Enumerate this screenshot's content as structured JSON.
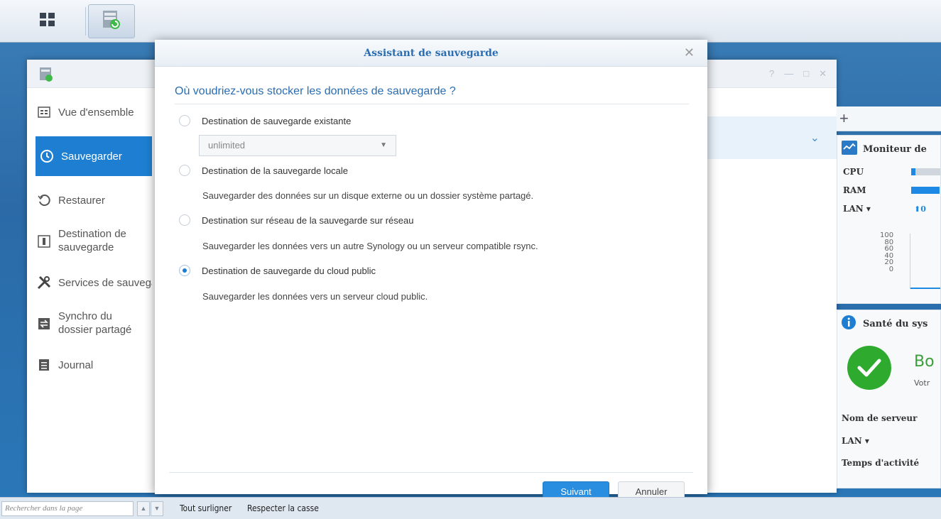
{
  "taskbar": {
    "apps_icon": "grid-icon",
    "active_app_icon": "hyper-backup-icon"
  },
  "app": {
    "sidebar": [
      {
        "label": "Vue d'ensemble",
        "icon": "overview-icon"
      },
      {
        "label": "Sauvegarder",
        "icon": "backup-icon"
      },
      {
        "label": "Restaurer",
        "icon": "restore-icon"
      },
      {
        "label": "Destination de sauvegarde",
        "icon": "destination-icon"
      },
      {
        "label": "Services de sauvegarde",
        "icon": "tools-icon"
      },
      {
        "label": "Synchro du dossier partagé",
        "icon": "sync-icon"
      },
      {
        "label": "Journal",
        "icon": "log-icon"
      }
    ]
  },
  "widgets": {
    "add": "+",
    "monitor": {
      "title": "Moniteur de",
      "cpu": "CPU",
      "ram": "RAM",
      "lan": "LAN ▾",
      "lan_value": "0",
      "cpu_pct": 0.15,
      "ram_pct": 0.8,
      "ticks": [
        "100",
        "80",
        "60",
        "40",
        "20",
        "0"
      ]
    },
    "health": {
      "title": "Santé du sys",
      "status": "Bo",
      "sub": "Votr",
      "server_name": "Nom de serveur",
      "lan": "LAN ▾",
      "uptime": "Temps d'activité"
    }
  },
  "dialog": {
    "title": "Assistant de sauvegarde",
    "question": "Où voudriez-vous stocker les données de sauvegarde ?",
    "options": [
      {
        "label": "Destination de sauvegarde existante",
        "checked": false
      },
      {
        "label": "Destination de la sauvegarde locale",
        "checked": false,
        "desc": "Sauvegarder des données sur un disque externe ou un dossier système partagé."
      },
      {
        "label": "Destination sur réseau de la sauvegarde sur réseau",
        "checked": false,
        "desc": "Sauvegarder les données vers un autre Synology ou un serveur compatible rsync."
      },
      {
        "label": "Destination de sauvegarde du cloud public",
        "checked": true,
        "desc": "Sauvegarder les données vers un serveur cloud public."
      }
    ],
    "select_value": "unlimited",
    "next": "Suivant",
    "cancel": "Annuler"
  },
  "findbar": {
    "placeholder": "Rechercher dans la page",
    "highlight_all": "Tout surligner",
    "match_case": "Respecter la casse"
  },
  "colors": {
    "accent": "#1e7fd2",
    "health_green": "#2eaa2e"
  }
}
